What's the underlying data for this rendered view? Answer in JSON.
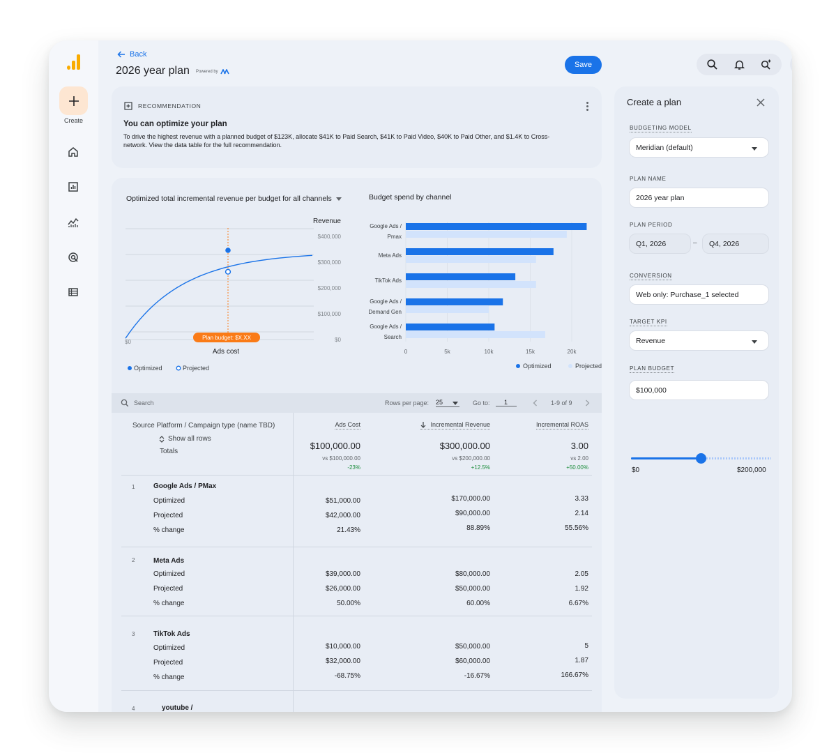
{
  "rail": {
    "create_label": "Create"
  },
  "header": {
    "back_label": "Back",
    "title": "2026 year plan",
    "powered_by": "Powered by",
    "save_label": "Save"
  },
  "recommendation": {
    "label": "RECOMMENDATION",
    "title": "You can optimize your plan",
    "body": "To drive the highest revenue with a planned budget of $123K, allocate $41K to Paid Search, $41K to Paid Video, $40K to Paid Other, and $1.4K to Cross-network. View the data table for the full recommendation."
  },
  "chart_data": [
    {
      "type": "line",
      "title": "Optimized total incremental revenue per budget for all channels",
      "xlabel": "Ads cost",
      "ylabel": "Revenue",
      "ylim": [
        0,
        400000
      ],
      "y_ticks": [
        "$400,000",
        "$300,000",
        "$200,000",
        "$100,000",
        "$0"
      ],
      "x_tick_left": "$0",
      "annotation": "Plan budget: $X.XX",
      "legend": [
        "Optimized",
        "Projected"
      ],
      "legend_position": "bottom-left",
      "optimized_point": {
        "revenue": 300000
      },
      "projected_point": {
        "revenue": 225000
      }
    },
    {
      "type": "bar",
      "title": "Budget spend by channel",
      "orientation": "horizontal",
      "categories": [
        "Google Ads / Pmax",
        "Meta Ads",
        "TikTok Ads",
        "Google Ads / Demand Gen",
        "Google Ads / Search"
      ],
      "category_lines": [
        [
          "Google Ads /",
          "Pmax"
        ],
        [
          "Meta Ads"
        ],
        [
          "TikTok Ads"
        ],
        [
          "Google Ads /",
          "Demand Gen"
        ],
        [
          "Google Ads /",
          "Search"
        ]
      ],
      "series": [
        {
          "name": "Optimized",
          "values": [
            21800,
            17800,
            13200,
            11700,
            10700
          ]
        },
        {
          "name": "Projected",
          "values": [
            19400,
            15700,
            15700,
            10000,
            16800
          ]
        }
      ],
      "x_ticks": [
        "0",
        "5k",
        "10k",
        "15k",
        "20k"
      ],
      "xlim": [
        0,
        20000
      ],
      "legend_position": "bottom"
    }
  ],
  "table": {
    "search_placeholder": "Search",
    "rows_per_page_label": "Rows per page:",
    "rows_per_page": "25",
    "goto_label": "Go to:",
    "goto_value": "1",
    "range": "1-9 of 9",
    "first_col_header": "Source Platform / Campaign type (name TBD)",
    "show_all_rows": "Show all rows",
    "totals_label": "Totals",
    "columns": [
      "Ads Cost",
      "Incremental Revenue",
      "Incremental ROAS"
    ],
    "totals": [
      {
        "value": "$100,000.00",
        "vs": "vs $100,000.00",
        "delta": "-23%"
      },
      {
        "value": "$300,000.00",
        "vs": "vs $200,000.00",
        "delta": "+12.5%"
      },
      {
        "value": "3.00",
        "vs": "vs 2.00",
        "delta": "+50.00%"
      }
    ],
    "rows": [
      {
        "index": "1",
        "name": "Google Ads / PMax",
        "sub": [
          "Optimized",
          "Projected",
          "% change"
        ],
        "cost": [
          "$51,000.00",
          "$42,000.00",
          "21.43%"
        ],
        "revenue": [
          "$170,000.00",
          "$90,000.00",
          "88.89%"
        ],
        "roas": [
          "3.33",
          "2.14",
          "55.56%"
        ]
      },
      {
        "index": "2",
        "name": "Meta Ads",
        "sub": [
          "Optimized",
          "Projected",
          "% change"
        ],
        "cost": [
          "$39,000.00",
          "$26,000.00",
          "50.00%"
        ],
        "revenue": [
          "$80,000.00",
          "$50,000.00",
          "60.00%"
        ],
        "roas": [
          "2.05",
          "1.92",
          "6.67%"
        ]
      },
      {
        "index": "3",
        "name": "TikTok Ads",
        "sub": [
          "Optimized",
          "Projected",
          "% change"
        ],
        "cost": [
          "$10,000.00",
          "$32,000.00",
          "-68.75%"
        ],
        "revenue": [
          "$50,000.00",
          "$60,000.00",
          "-16.67%"
        ],
        "roas": [
          "5",
          "1.87",
          "166.67%"
        ]
      },
      {
        "index": "4",
        "name": "youtube /"
      }
    ]
  },
  "panel": {
    "title": "Create a plan",
    "budgeting_model_label": "BUDGETING MODEL",
    "budgeting_model": "Meridian (default)",
    "plan_name_label": "PLAN NAME",
    "plan_name": "2026 year plan",
    "plan_period_label": "PLAN PERIOD",
    "period_start": "Q1, 2026",
    "period_sep": "–",
    "period_end": "Q4, 2026",
    "conversion_label": "CONVERSION",
    "conversion": "Web only:  Purchase_1 selected",
    "target_kpi_label": "TARGET KPI",
    "target_kpi": "Revenue",
    "plan_budget_label": "PLAN BUDGET",
    "plan_budget": "$100,000",
    "slider_min": "$0",
    "slider_max": "$200,000",
    "slider_fraction": 0.5
  },
  "colors": {
    "accent": "#1a73e8",
    "projected": "#d2e3fc",
    "annotation": "#fa7b17",
    "positive": "#1e8e3e"
  }
}
